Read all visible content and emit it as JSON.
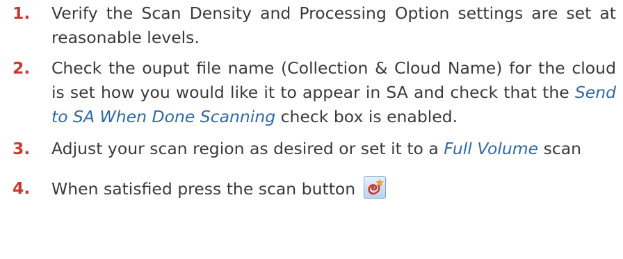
{
  "steps": [
    {
      "number": "1.",
      "text": "Verify the Scan Density and Processing Option settings are set at reasonable levels."
    },
    {
      "number": "2.",
      "text_before": "Check the ouput file name (Collection & Cloud Name) for the cloud is set how you would like it to appear in SA and check that the ",
      "link_text": "Send to SA When Done Scanning",
      "text_after": " check box is enabled."
    },
    {
      "number": "3.",
      "text_before": "Adjust your scan region as desired or set it to a ",
      "link_text": "Full Volume",
      "text_after": " scan"
    },
    {
      "number": "4.",
      "text": "When satisfied press the scan button",
      "icon": "scan-button-icon"
    }
  ],
  "colors": {
    "step_number": "#c8392e",
    "body_text": "#3a3a3a",
    "emphasis": "#2f6aa8"
  }
}
